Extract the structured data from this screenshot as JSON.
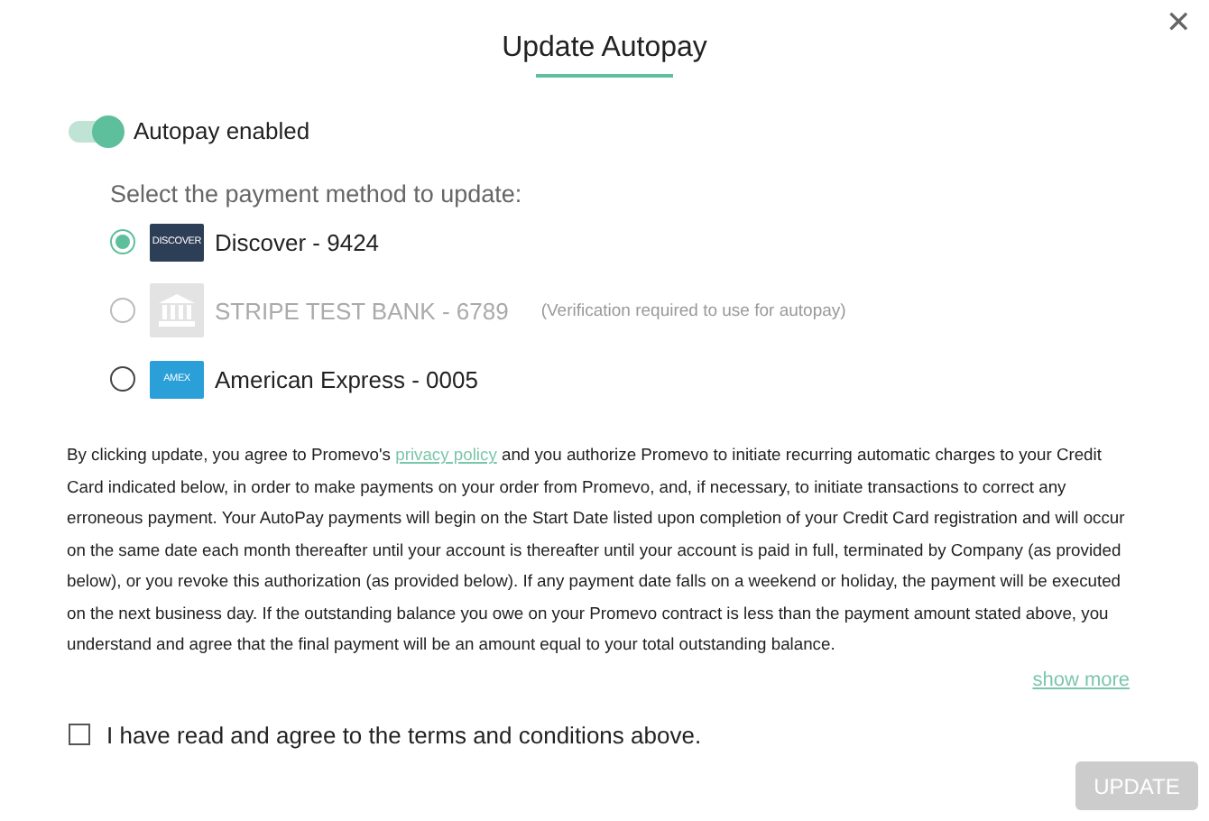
{
  "dialog": {
    "title": "Update Autopay",
    "close": "✕"
  },
  "autopay": {
    "label": "Autopay enabled",
    "on": true
  },
  "prompt": "Select the payment method to update:",
  "methods": [
    {
      "kind": "card",
      "logo_text": "DISCOVER",
      "color": "#2d3e57",
      "label": "Discover - 9424",
      "selected": true,
      "disabled": false
    },
    {
      "kind": "bank",
      "label": "STRIPE TEST BANK - 6789",
      "note": "(Verification required to use for autopay)",
      "selected": false,
      "disabled": true
    },
    {
      "kind": "card",
      "logo_text": "AMEX",
      "color": "#2a9fd8",
      "label": "American Express - 0005",
      "selected": false,
      "disabled": false
    }
  ],
  "terms": {
    "before": "By clicking update, you agree to Promevo's ",
    "link": "privacy policy",
    "after": " and you authorize Promevo to initiate recurring automatic charges to your Credit Card indicated below, in order to make payments on your order from Promevo, and, if necessary, to initiate transactions to correct any erroneous payment. Your AutoPay payments will begin on the Start Date listed upon completion of your Credit Card registration and will occur on the same date each month thereafter until your account is thereafter until your account is paid in full, terminated by Company (as provided below), or you revoke this authorization (as provided below). If any payment date falls on a weekend or holiday, the payment will be executed on the next business day. If the outstanding balance you owe on your Promevo contract is less than the payment amount stated above, you understand and agree that the final payment will be an amount equal to your total outstanding balance."
  },
  "show_more": "show more",
  "agree": {
    "label": "I have read and agree to the terms and conditions above.",
    "checked": false
  },
  "update_button": {
    "label": "UPDATE",
    "disabled": true
  }
}
